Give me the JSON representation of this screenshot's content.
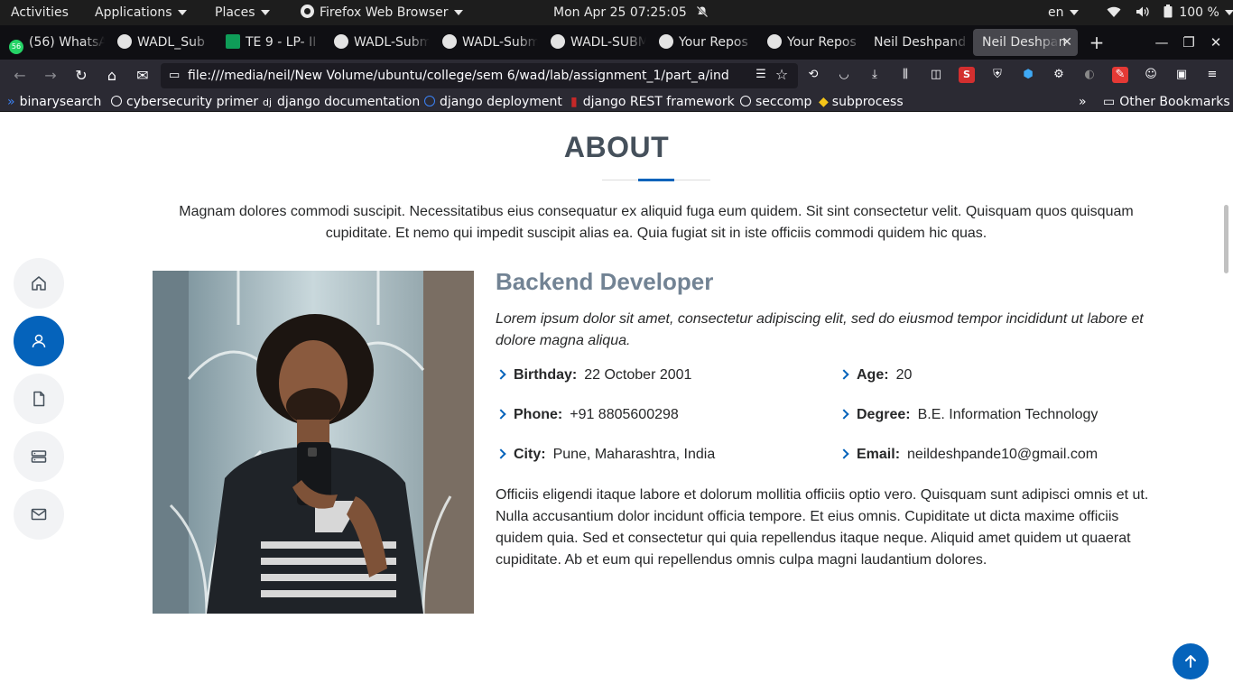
{
  "topbar": {
    "activities": "Activities",
    "applications": "Applications",
    "places": "Places",
    "app_name": "Firefox Web Browser",
    "clock": "Mon Apr 25  07:25:05",
    "lang": "en",
    "battery": "100 %"
  },
  "tabs": [
    {
      "label": "(56) WhatsA",
      "icon": "whatsapp-icon",
      "badge": "56"
    },
    {
      "label": "WADL_Sub",
      "icon": "github-icon"
    },
    {
      "label": "TE 9 - LP- II",
      "icon": "sheets-icon"
    },
    {
      "label": "WADL-Subm",
      "icon": "github-icon"
    },
    {
      "label": "WADL-Subm",
      "icon": "github-icon"
    },
    {
      "label": "WADL-SUBM",
      "icon": "github-icon"
    },
    {
      "label": "Your Repos",
      "icon": "github-icon"
    },
    {
      "label": "Your Repos",
      "icon": "github-icon"
    },
    {
      "label": "Neil Deshpand",
      "icon": ""
    },
    {
      "label": "Neil Deshpan",
      "icon": "",
      "active": true
    }
  ],
  "url": "file:///media/neil/New Volume/ubuntu/college/sem 6/wad/lab/assignment_1/part_a/ind",
  "bookmarks": [
    {
      "label": "binarysearch"
    },
    {
      "label": "cybersecurity primer"
    },
    {
      "label": "django documentation"
    },
    {
      "label": "django deployment"
    },
    {
      "label": "django REST framework"
    },
    {
      "label": "seccomp"
    },
    {
      "label": "subprocess"
    }
  ],
  "other_bookmarks": "Other Bookmarks",
  "about": {
    "title": "ABOUT",
    "intro": "Magnam dolores commodi suscipit. Necessitatibus eius consequatur ex aliquid fuga eum quidem. Sit sint consectetur velit. Quisquam quos quisquam cupiditate. Et nemo qui impedit suscipit alias ea. Quia fugiat sit in iste officiis commodi quidem hic quas.",
    "role": "Backend Developer",
    "tagline": "Lorem ipsum dolor sit amet, consectetur adipiscing elit, sed do eiusmod tempor incididunt ut labore et dolore magna aliqua.",
    "info": [
      {
        "label": "Birthday:",
        "value": "22 October 2001"
      },
      {
        "label": "Age:",
        "value": "20"
      },
      {
        "label": "Phone:",
        "value": "+91 8805600298"
      },
      {
        "label": "Degree:",
        "value": "B.E. Information Technology"
      },
      {
        "label": "City:",
        "value": "Pune, Maharashtra, India"
      },
      {
        "label": "Email:",
        "value": "neildeshpande10@gmail.com"
      }
    ],
    "paragraph": "Officiis eligendi itaque labore et dolorum mollitia officiis optio vero. Quisquam sunt adipisci omnis et ut. Nulla accusantium dolor incidunt officia tempore. Et eius omnis. Cupiditate ut dicta maxime officiis quidem quia. Sed et consectetur qui quia repellendus itaque neque. Aliquid amet quidem ut quaerat cupiditate. Ab et eum qui repellendus omnis culpa magni laudantium dolores."
  },
  "sidenav": [
    {
      "icon": "home-icon"
    },
    {
      "icon": "user-icon",
      "active": true
    },
    {
      "icon": "file-icon"
    },
    {
      "icon": "server-icon"
    },
    {
      "icon": "envelope-icon"
    }
  ],
  "colors": {
    "accent": "#0563bb",
    "heading": "#45505b",
    "role": "#728394"
  }
}
